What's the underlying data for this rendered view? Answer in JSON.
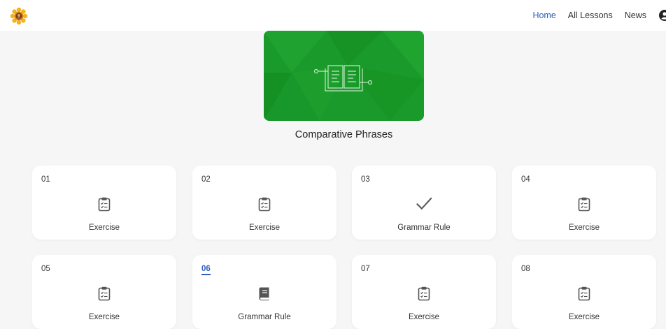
{
  "header": {
    "logo_icon": "sunflower-logo-icon",
    "nav": {
      "home": "Home",
      "all_lessons": "All Lessons",
      "news": "News"
    },
    "account_icon": "account-icon",
    "active_color": "#2e5fb8"
  },
  "lesson": {
    "title": "Comparative Phrases",
    "banner_icon": "open-book-circuit-icon",
    "banner_color": "#1a9a2a"
  },
  "cards": [
    {
      "number": "01",
      "label": "Exercise",
      "icon": "clipboard-checklist-icon",
      "active": false
    },
    {
      "number": "02",
      "label": "Exercise",
      "icon": "clipboard-checklist-icon",
      "active": false
    },
    {
      "number": "03",
      "label": "Grammar Rule",
      "icon": "checkmark-icon",
      "active": false
    },
    {
      "number": "04",
      "label": "Exercise",
      "icon": "clipboard-checklist-icon",
      "active": false
    },
    {
      "number": "05",
      "label": "Exercise",
      "icon": "clipboard-checklist-icon",
      "active": false
    },
    {
      "number": "06",
      "label": "Grammar Rule",
      "icon": "book-icon",
      "active": true
    },
    {
      "number": "07",
      "label": "Exercise",
      "icon": "clipboard-checklist-icon",
      "active": false
    },
    {
      "number": "08",
      "label": "Exercise",
      "icon": "clipboard-checklist-icon",
      "active": false
    }
  ]
}
